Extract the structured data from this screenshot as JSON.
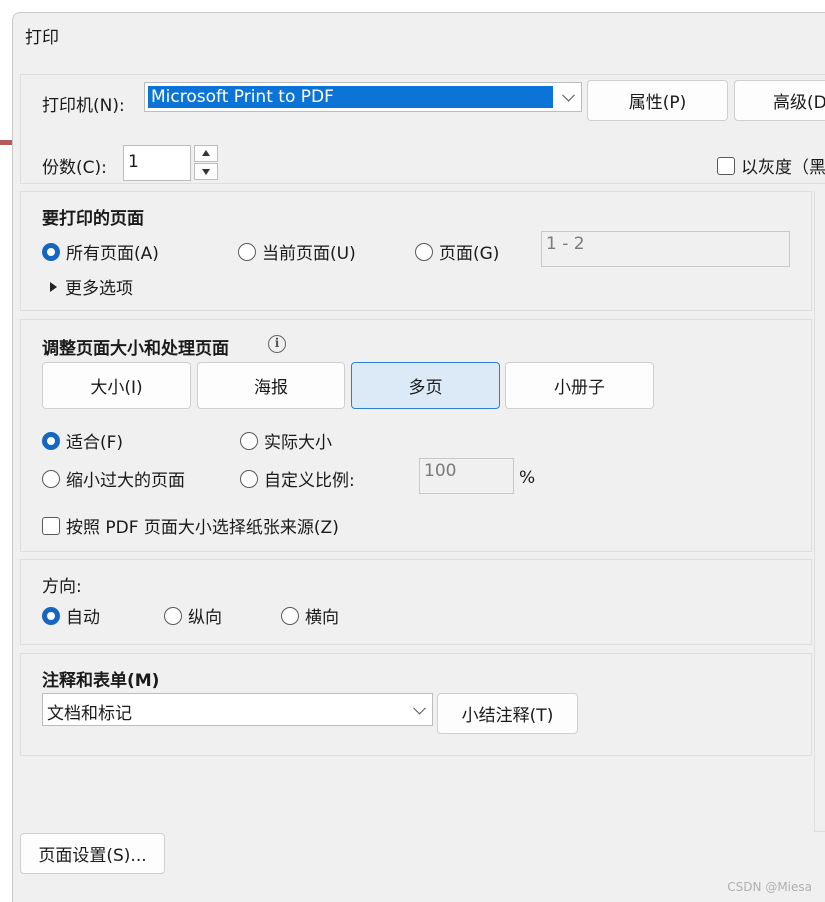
{
  "dialog": {
    "title": "打印"
  },
  "printer": {
    "label": "打印机(N):",
    "selected": "Microsoft Print to PDF",
    "properties_button": "属性(P)",
    "advanced_button": "高级(D"
  },
  "copies": {
    "label": "份数(C):",
    "value": "1",
    "grayscale_label": "以灰度（黑"
  },
  "pages_to_print": {
    "heading": "要打印的页面",
    "all": "所有页面(A)",
    "current": "当前页面(U)",
    "pages": "页面(G)",
    "range_value": "1 - 2",
    "more_options": "更多选项"
  },
  "sizing": {
    "heading": "调整页面大小和处理页面",
    "tabs": [
      "大小(I)",
      "海报",
      "多页",
      "小册子"
    ],
    "active_tab": "多页",
    "fit": "适合(F)",
    "actual_size": "实际大小",
    "shrink": "缩小过大的页面",
    "custom_scale": "自定义比例:",
    "scale_value": "100",
    "percent": "%",
    "paper_source": "按照 PDF 页面大小选择纸张来源(Z)"
  },
  "orientation": {
    "heading": "方向:",
    "auto": "自动",
    "portrait": "纵向",
    "landscape": "横向"
  },
  "comments": {
    "heading": "注释和表单(M)",
    "selected": "文档和标记",
    "summarize_button": "小结注释(T)"
  },
  "footer": {
    "page_setup_button": "页面设置(S)..."
  },
  "watermark": "CSDN @Miesa",
  "colors": {
    "accent": "#0b74d6",
    "active_tab_bg": "#dceaf7"
  }
}
